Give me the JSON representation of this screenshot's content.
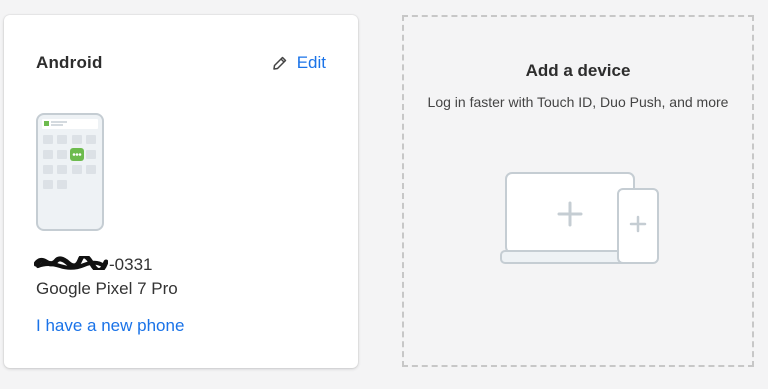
{
  "device_card": {
    "title": "Android",
    "edit_label": "Edit",
    "phone_number_suffix": "-0331",
    "model": "Google Pixel 7 Pro",
    "new_phone_link": "I have a new phone"
  },
  "add_device": {
    "title": "Add a device",
    "description": "Log in faster with Touch ID, Duo Push, and more"
  },
  "icons": {
    "edit": "pencil-icon",
    "phone": "android-phone-illustration",
    "add": "laptop-phone-plus-illustration"
  },
  "colors": {
    "link": "#1a73e8",
    "duo_green": "#6dbb4e",
    "illustration_stroke": "#c5cdd3",
    "illustration_fill": "#eef2f5"
  }
}
